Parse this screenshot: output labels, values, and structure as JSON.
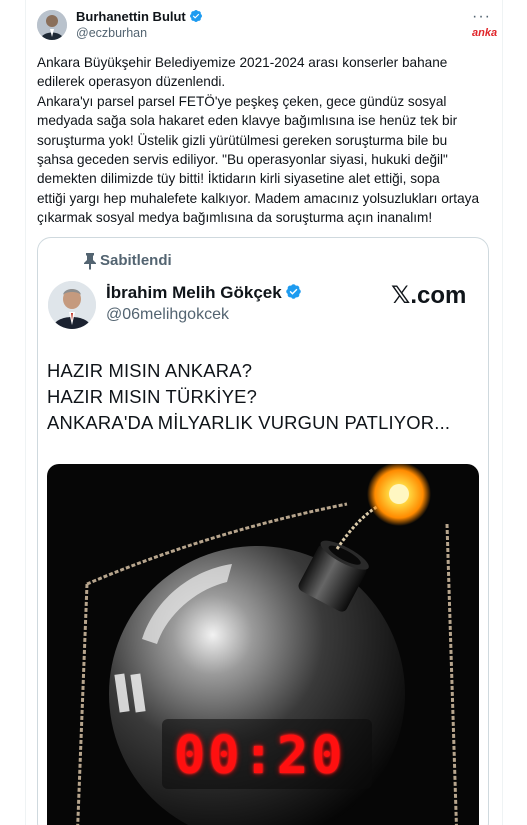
{
  "author": {
    "name": "Burhanettin Bulut",
    "handle": "@eczburhan"
  },
  "menu": {
    "more_label": "···"
  },
  "watermark": "anka",
  "tweet_lines": [
    "Ankara Büyükşehir Belediyemize 2021-2024 arası konserler bahane",
    "edilerek operasyon düzenlendi.",
    "Ankara'yı parsel parsel FETÖ'ye peşkeş çeken, gece gündüz sosyal",
    "medyada sağa sola hakaret eden klavye bağımlısına ise henüz tek bir",
    "soruşturma yok!  Üstelik gizli yürütülmesi gereken soruşturma bile bu",
    "şahsa geceden servis ediliyor.  \"Bu operasyonlar siyasi, hukuki değil\"",
    "demekten dilimizde tüy bitti!  İktidarın kirli siyasetine alet ettiği, sopa",
    "ettiği yargı hep muhalefete kalkıyor. Madem amacınız yolsuzlukları ortaya",
    "çıkarmak sosyal medya bağımlısına da soruşturma açın inanalım!"
  ],
  "quote": {
    "pinned_label": "Sabitlendi",
    "name": "İbrahim Melih Gökçek",
    "handle": "@06melihgokcek",
    "brand": "𝕏.com",
    "headline": [
      "HAZIR MISIN ANKARA?",
      "HAZIR MISIN TÜRKİYE?",
      "ANKARA'DA MİLYARLIK VURGUN PATLIYOR..."
    ],
    "timer": "00:20"
  },
  "icons": {
    "verified": "verified-badge-icon",
    "pin": "pin-icon",
    "more": "more-dots-icon"
  },
  "colors": {
    "verified_blue": "#1d9bf0",
    "secondary_text": "#536471",
    "timer_red": "#ff1010"
  }
}
